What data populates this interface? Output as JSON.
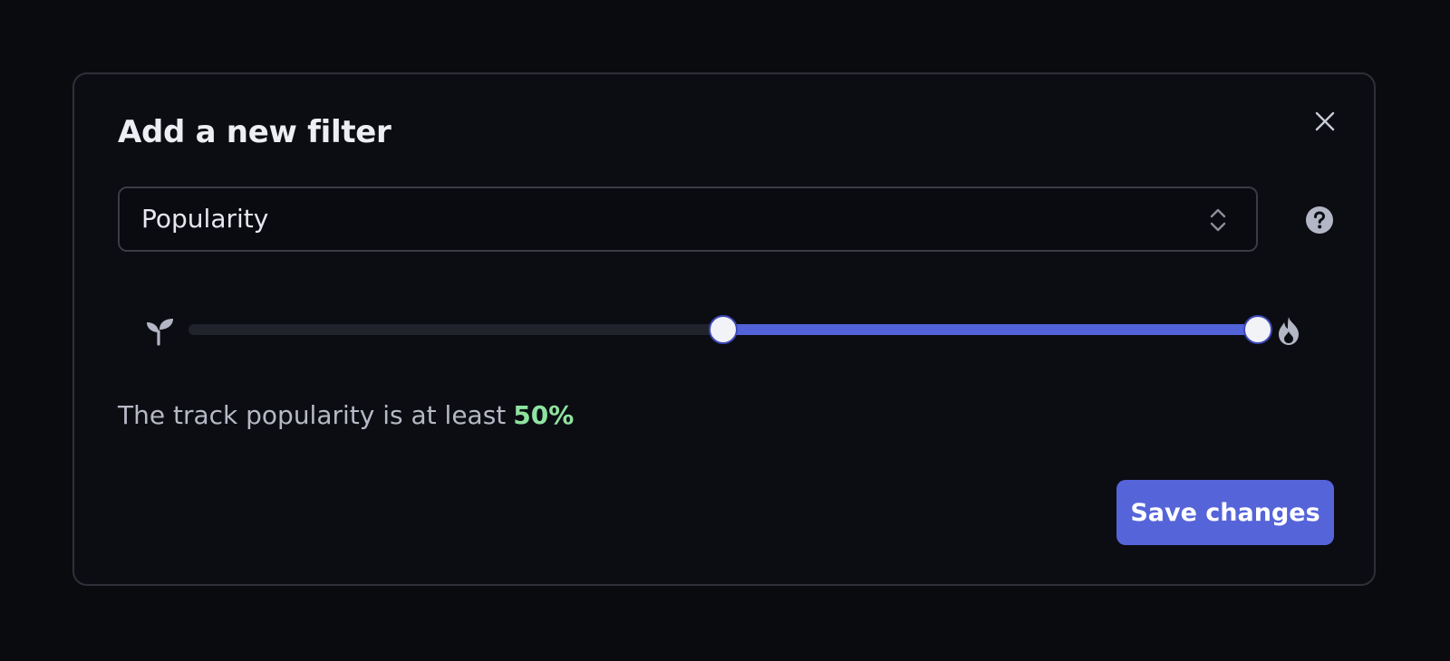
{
  "dialog": {
    "title": "Add a new filter",
    "close_icon": "close-icon"
  },
  "filter_select": {
    "value": "Popularity",
    "icon": "chevron-up-down-icon"
  },
  "help_icon": "question-circle-icon",
  "slider": {
    "min_icon": "sprout-icon",
    "max_icon": "flame-icon",
    "range_min": 0,
    "range_max": 100,
    "low_value": 50,
    "high_value": 100
  },
  "info": {
    "text": "The track popularity is at least",
    "value": "50%"
  },
  "save_button": {
    "label": "Save changes"
  },
  "colors": {
    "accent": "#5664d9",
    "highlight": "#8fe3a0",
    "background": "#0a0b0f"
  }
}
